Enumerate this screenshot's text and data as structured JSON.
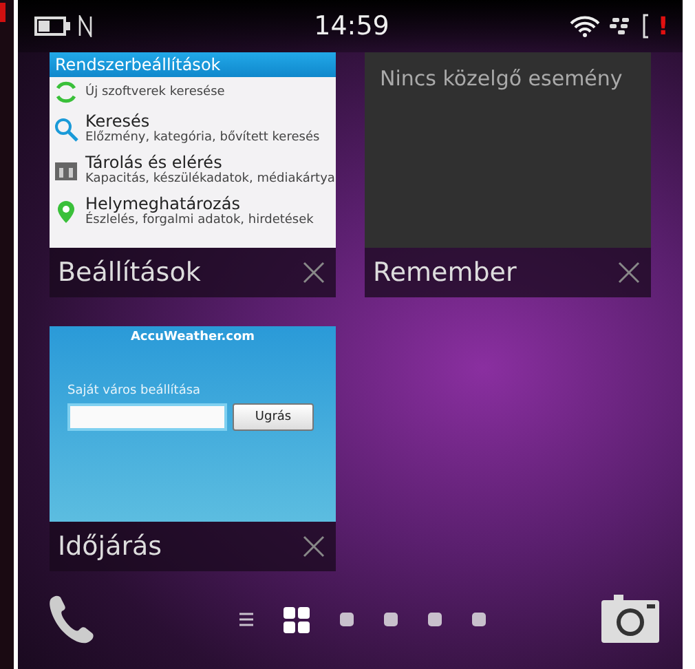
{
  "status_bar": {
    "time": "14:59",
    "alert": "!"
  },
  "frames": [
    {
      "kind": "settings",
      "title": "Beállítások",
      "header": "Rendszerbeállítások",
      "items": [
        {
          "kind": "refresh",
          "subtitle": "Új szoftverek keresése"
        },
        {
          "kind": "search",
          "title": "Keresés",
          "subtitle": "Előzmény, kategória, bővített keresés"
        },
        {
          "kind": "storage",
          "title": "Tárolás és elérés",
          "subtitle": "Kapacitás, készülékadatok, médiakártya"
        },
        {
          "kind": "pin",
          "title": "Helymeghatározás",
          "subtitle": "Észlelés, forgalmi adatok, hirdetések"
        }
      ]
    },
    {
      "kind": "remember",
      "title": "Remember",
      "message": "Nincs közelgő esemény"
    },
    {
      "kind": "weather",
      "title": "Időjárás",
      "brand": "AccuWeather.com",
      "label": "Saját város beállítása",
      "button": "Ugrás"
    }
  ],
  "pager": [
    {
      "kind": "list",
      "selected": false
    },
    {
      "kind": "grid",
      "selected": true
    },
    {
      "kind": "dot",
      "selected": false
    },
    {
      "kind": "dot",
      "selected": false
    },
    {
      "kind": "dot",
      "selected": false
    },
    {
      "kind": "dot",
      "selected": false
    }
  ]
}
